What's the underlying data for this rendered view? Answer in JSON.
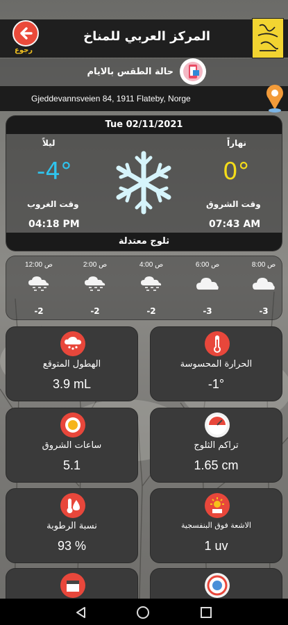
{
  "header": {
    "back_label": "رجوع",
    "title": "المركز العربي للمناخ",
    "logo_text": "المركز العربي للمناخ"
  },
  "subheader": {
    "label": "حالة الطقس بالايام"
  },
  "location": {
    "address": "Gjeddevannsveien 84, 1911 Flateby, Norge"
  },
  "today": {
    "date": "Tue  02/11/2021",
    "night_label": "ليلاً",
    "night_temp": "-4°",
    "day_label": "نهاراً",
    "day_temp": "0°",
    "sunset_label": "وقت الغروب",
    "sunset_time": "04:18 PM",
    "sunrise_label": "وقت الشروق",
    "sunrise_time": "07:43 AM",
    "condition": "ثلوج معتدلة",
    "icon": "snowflake-icon"
  },
  "hourly": [
    {
      "time": "12:00 ص",
      "temp": "-2",
      "icon": "cloud-snow-icon"
    },
    {
      "time": "2:00 ص",
      "temp": "-2",
      "icon": "cloud-snow-icon"
    },
    {
      "time": "4:00 ص",
      "temp": "-2",
      "icon": "cloud-snow-icon"
    },
    {
      "time": "6:00 ص",
      "temp": "-3",
      "icon": "cloud-icon"
    },
    {
      "time": "8:00 ص",
      "temp": "-3",
      "icon": "cloud-icon"
    }
  ],
  "details": [
    {
      "label": "الهطول المتوقع",
      "value": "3.9 mL",
      "icon": "rain-cloud-icon",
      "color": "#e8473b"
    },
    {
      "label": "الحرارة المحسوسة",
      "value": "-1°",
      "icon": "thermometer-icon",
      "color": "#e8473b"
    },
    {
      "label": "ساعات الشروق",
      "value": "5.1",
      "icon": "sun-icon",
      "color": "#e8473b"
    },
    {
      "label": "تراكم الثلوج",
      "value": "1.65 cm",
      "icon": "snow-gauge-icon",
      "color": "#e8473b"
    },
    {
      "label": "نسبة الرطوبة",
      "value": "93 %",
      "icon": "humidity-icon",
      "color": "#e8473b"
    },
    {
      "label": "الاشعة فوق البنفسجية",
      "value": "1 uv",
      "icon": "uv-icon",
      "color": "#e8473b"
    },
    {
      "label": "",
      "value": "",
      "icon": "calendar-icon",
      "color": "#e8473b"
    },
    {
      "label": "",
      "value": "",
      "icon": "compass-icon",
      "color": "#e8473b"
    }
  ],
  "colors": {
    "accent_red": "#ea4a3a",
    "night_blue": "#2fc4ee",
    "day_yellow": "#f4dc1a",
    "logo_yellow": "#f2d431"
  }
}
